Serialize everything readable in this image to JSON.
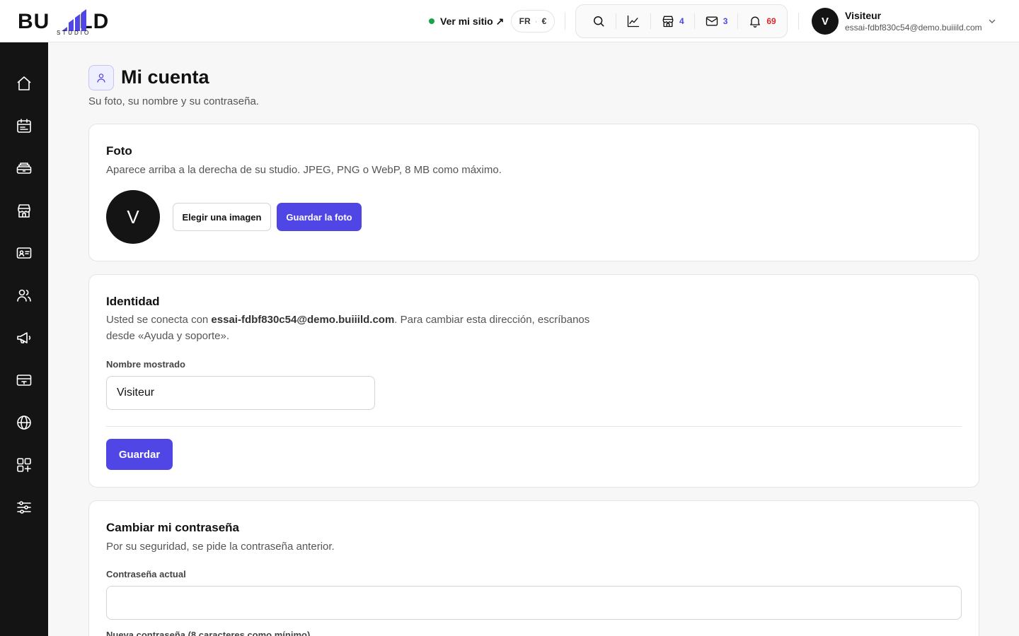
{
  "brand": {
    "name_left": "BU",
    "name_right": "LD",
    "sub": "STUDIO"
  },
  "header": {
    "site_link_label": "Ver mi sitio ↗",
    "lang": "FR",
    "currency": "€",
    "shop_count": "4",
    "mail_count": "3",
    "notif_count": "69",
    "user_initial": "V",
    "user_name": "Visiteur",
    "user_email": "essai-fdbf830c54@demo.buiiild.com"
  },
  "sidebar": {
    "items": [
      "home-icon",
      "calendar-icon",
      "inbox-stack-icon",
      "store-icon",
      "id-card-icon",
      "users-icon",
      "megaphone-icon",
      "ticket-icon",
      "globe-icon",
      "apps-add-icon",
      "sliders-icon"
    ]
  },
  "page": {
    "title": "Mi cuenta",
    "subtitle": "Su foto, su nombre y su contraseña."
  },
  "photo": {
    "title": "Foto",
    "desc": "Aparece arriba a la derecha de su studio. JPEG, PNG o WebP, 8 MB como máximo.",
    "initial": "V",
    "choose_label": "Elegir una imagen",
    "save_label": "Guardar la foto"
  },
  "identity": {
    "title": "Identidad",
    "desc_prefix": "Usted se conecta con ",
    "email": "essai-fdbf830c54@demo.buiiild.com",
    "desc_suffix": ". Para cambiar esta dirección, escríbanos desde «Ayuda y soporte».",
    "name_label": "Nombre mostrado",
    "name_value": "Visiteur",
    "save_label": "Guardar"
  },
  "password": {
    "title": "Cambiar mi contraseña",
    "desc": "Por su seguridad, se pide la contraseña anterior.",
    "current_label": "Contraseña actual",
    "current_value": "",
    "new_label": "Nueva contraseña (8 caracteres como mínimo)"
  },
  "colors": {
    "accent": "#4f46e5",
    "sidebar_bg": "#141414",
    "notif_red": "#dc2626",
    "online_green": "#16a34a"
  }
}
